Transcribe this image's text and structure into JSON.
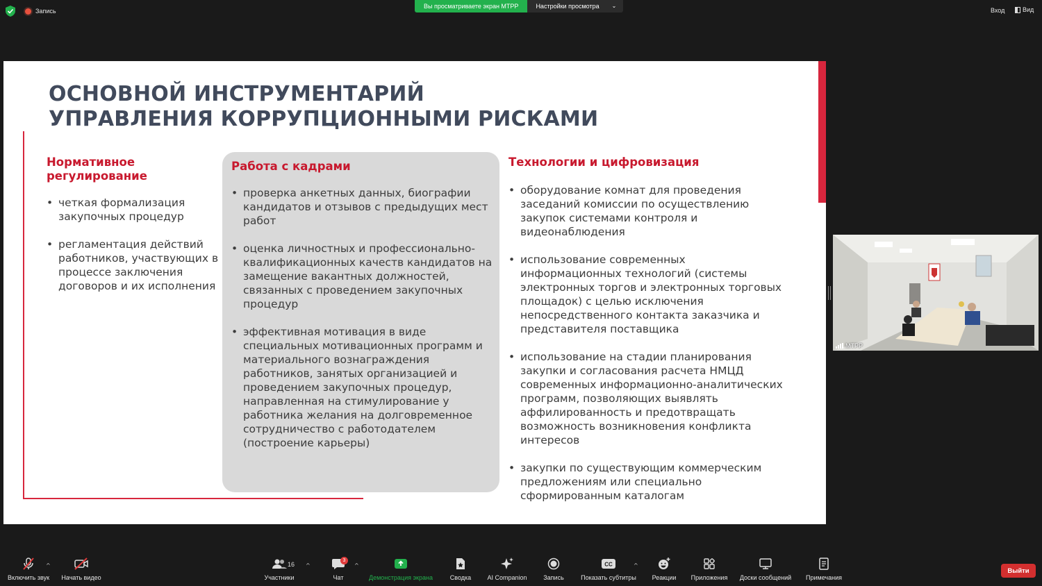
{
  "topbar": {
    "record_label": "Запись",
    "sharing_notice": "Вы просматриваете экран МТРР",
    "view_settings_label": "Настройки просмотра",
    "login_label": "Вход",
    "view_label": "Вид"
  },
  "slide": {
    "title_line1": "ОСНОВНОЙ ИНСТРУМЕНТАРИЙ",
    "title_line2": "УПРАВЛЕНИЯ КОРРУПЦИОННЫМИ РИСКАМИ",
    "col1": {
      "heading_line1": "Нормативное",
      "heading_line2": "регулирование",
      "items": [
        "четкая формализация закупочных процедур",
        "регламентация действий работников, участвующих в процессе заключения договоров и их исполнения"
      ]
    },
    "col2": {
      "heading": "Работа с кадрами",
      "items": [
        "проверка анкетных данных, биографии кандидатов и отзывов с предыдущих мест работ",
        "оценка личностных и профессионально-квалификационных качеств кандидатов на замещение вакантных должностей, связанных с проведением закупочных процедур",
        "эффективная мотивация в виде специальных мотивационных программ и материального вознаграждения работников, занятых организацией и проведением закупочных процедур, направленная на стимулирование у работника желания на долговременное сотрудничество с работодателем (построение карьеры)"
      ]
    },
    "col3": {
      "heading": "Технологии и цифровизация",
      "items": [
        "оборудование комнат для проведения заседаний комиссии по осуществлению закупок системами контроля и видеонаблюдения",
        "использование современных информационных технологий (системы электронных торгов и электронных торговых площадок) с целью исключения непосредственного контакта заказчика и представителя поставщика",
        "использование на стадии планирования закупки и согласования расчета НМЦД современных информационно-аналитических программ, позволяющих выявлять аффилированность и предотвращать возможность возникновения конфликта интересов",
        "закупки по существующим коммерческим предложениям или специально сформированным каталогам"
      ]
    }
  },
  "video": {
    "participant_name": "МТРР"
  },
  "toolbar": {
    "unmute_label": "Включить звук",
    "start_video_label": "Начать видео",
    "participants_label": "Участники",
    "participants_count": "16",
    "chat_label": "Чат",
    "chat_badge": "3",
    "share_label": "Демонстрация экрана",
    "summary_label": "Сводка",
    "ai_label": "AI Companion",
    "record_label": "Запись",
    "captions_label": "Показать субтитры",
    "captions_icon_text": "CC",
    "reactions_label": "Реакции",
    "apps_label": "Приложения",
    "whiteboards_label": "Доски сообщений",
    "notes_label": "Примечания",
    "leave_label": "Выйти"
  },
  "colors": {
    "accent_red": "#c8192e",
    "share_green": "#23b14d",
    "slide_title": "#414a5c"
  }
}
